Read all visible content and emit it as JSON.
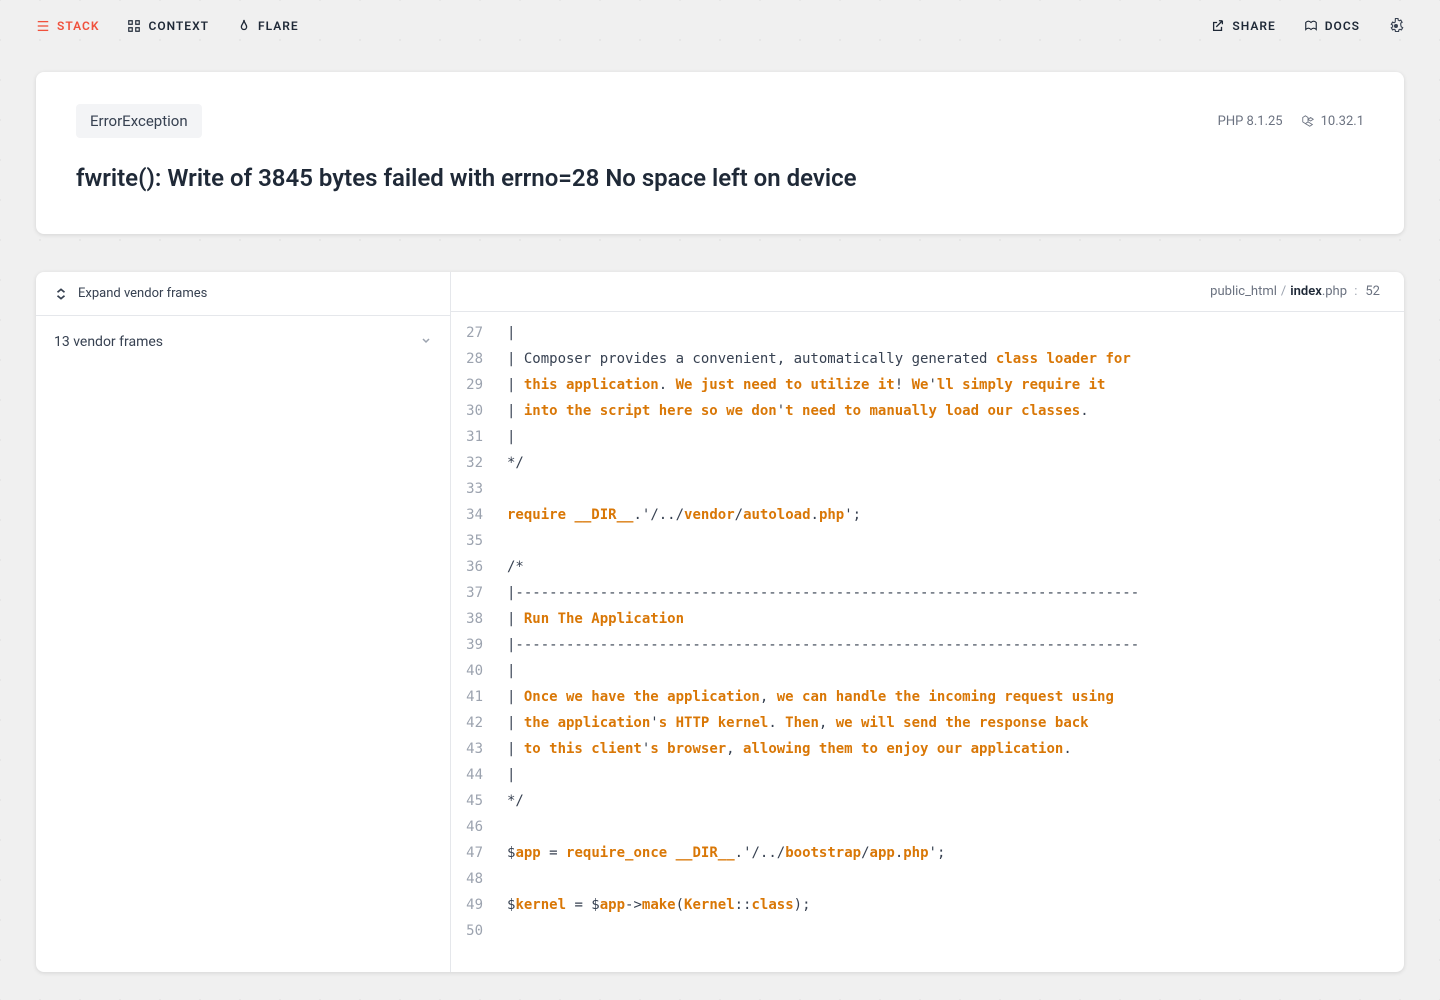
{
  "nav": {
    "stack": "STACK",
    "context": "CONTEXT",
    "flare": "FLARE",
    "share": "SHARE",
    "docs": "DOCS"
  },
  "error": {
    "type": "ErrorException",
    "php_version": "PHP 8.1.25",
    "laravel_version": "10.32.1",
    "message": "fwrite(): Write of 3845 bytes failed with errno=28 No space left on device"
  },
  "sidebar": {
    "expand_label": "Expand vendor frames",
    "vendor_frames": "13 vendor frames"
  },
  "breadcrumb": {
    "dir": "public_html",
    "file": "index",
    "ext": ".php",
    "line": "52"
  },
  "code": [
    {
      "n": 27,
      "segs": [
        [
          "",
          "|"
        ]
      ]
    },
    {
      "n": 28,
      "segs": [
        [
          "",
          "| Composer provides a convenient, automatically generated "
        ],
        [
          "o",
          "class"
        ],
        [
          "",
          " "
        ],
        [
          "o",
          "loader"
        ],
        [
          "",
          " "
        ],
        [
          "o",
          "for"
        ]
      ]
    },
    {
      "n": 29,
      "segs": [
        [
          "",
          "| "
        ],
        [
          "o",
          "this application"
        ],
        [
          "",
          ". "
        ],
        [
          "o",
          "We just need to utilize it"
        ],
        [
          "",
          "! "
        ],
        [
          "o",
          "We"
        ],
        [
          "",
          "'"
        ],
        [
          "o",
          "ll simply require it"
        ]
      ]
    },
    {
      "n": 30,
      "segs": [
        [
          "",
          "| "
        ],
        [
          "o",
          "into the script here so we don"
        ],
        [
          "",
          "'"
        ],
        [
          "o",
          "t need to manually load our classes"
        ],
        [
          "",
          "."
        ]
      ]
    },
    {
      "n": 31,
      "segs": [
        [
          "",
          "|"
        ]
      ]
    },
    {
      "n": 32,
      "segs": [
        [
          "",
          "*/"
        ]
      ]
    },
    {
      "n": 33,
      "segs": [
        [
          "",
          ""
        ]
      ]
    },
    {
      "n": 34,
      "segs": [
        [
          "o",
          "require"
        ],
        [
          "",
          " "
        ],
        [
          "o",
          "__DIR__"
        ],
        [
          "",
          ".'/../"
        ],
        [
          "o",
          "vendor"
        ],
        [
          "",
          "/"
        ],
        [
          "o",
          "autoload"
        ],
        [
          "",
          "."
        ],
        [
          "o",
          "php"
        ],
        [
          "",
          "';"
        ]
      ]
    },
    {
      "n": 35,
      "segs": [
        [
          "",
          ""
        ]
      ]
    },
    {
      "n": 36,
      "segs": [
        [
          "",
          "/*"
        ]
      ]
    },
    {
      "n": 37,
      "segs": [
        [
          "",
          "|--------------------------------------------------------------------------"
        ]
      ]
    },
    {
      "n": 38,
      "segs": [
        [
          "",
          "| "
        ],
        [
          "o",
          "Run The Application"
        ]
      ]
    },
    {
      "n": 39,
      "segs": [
        [
          "",
          "|--------------------------------------------------------------------------"
        ]
      ]
    },
    {
      "n": 40,
      "segs": [
        [
          "",
          "|"
        ]
      ]
    },
    {
      "n": 41,
      "segs": [
        [
          "",
          "| "
        ],
        [
          "o",
          "Once we have the application"
        ],
        [
          "",
          ", "
        ],
        [
          "o",
          "we can handle the incoming request using"
        ]
      ]
    },
    {
      "n": 42,
      "segs": [
        [
          "",
          "| "
        ],
        [
          "o",
          "the application"
        ],
        [
          "",
          "'"
        ],
        [
          "o",
          "s HTTP kernel"
        ],
        [
          "",
          ". "
        ],
        [
          "o",
          "Then"
        ],
        [
          "",
          ", "
        ],
        [
          "o",
          "we will send the response back"
        ]
      ]
    },
    {
      "n": 43,
      "segs": [
        [
          "",
          "| "
        ],
        [
          "o",
          "to this client"
        ],
        [
          "",
          "'"
        ],
        [
          "o",
          "s browser"
        ],
        [
          "",
          ", "
        ],
        [
          "o",
          "allowing them to enjoy our application"
        ],
        [
          "",
          "."
        ]
      ]
    },
    {
      "n": 44,
      "segs": [
        [
          "",
          "|"
        ]
      ]
    },
    {
      "n": 45,
      "segs": [
        [
          "",
          "*/"
        ]
      ]
    },
    {
      "n": 46,
      "segs": [
        [
          "",
          ""
        ]
      ]
    },
    {
      "n": 47,
      "segs": [
        [
          "",
          "$"
        ],
        [
          "o",
          "app"
        ],
        [
          "",
          " = "
        ],
        [
          "o",
          "require_once"
        ],
        [
          "",
          " "
        ],
        [
          "o",
          "__DIR__"
        ],
        [
          "",
          ".'/../"
        ],
        [
          "o",
          "bootstrap"
        ],
        [
          "",
          "/"
        ],
        [
          "o",
          "app"
        ],
        [
          "",
          "."
        ],
        [
          "o",
          "php"
        ],
        [
          "",
          "';"
        ]
      ]
    },
    {
      "n": 48,
      "segs": [
        [
          "",
          ""
        ]
      ]
    },
    {
      "n": 49,
      "segs": [
        [
          "",
          "$"
        ],
        [
          "o",
          "kernel"
        ],
        [
          "",
          " = $"
        ],
        [
          "o",
          "app"
        ],
        [
          "",
          "->"
        ],
        [
          "o",
          "make"
        ],
        [
          "",
          "("
        ],
        [
          "o",
          "Kernel"
        ],
        [
          "",
          "::"
        ],
        [
          "o",
          "class"
        ],
        [
          "",
          ");"
        ]
      ]
    },
    {
      "n": 50,
      "segs": [
        [
          "",
          ""
        ]
      ]
    }
  ]
}
